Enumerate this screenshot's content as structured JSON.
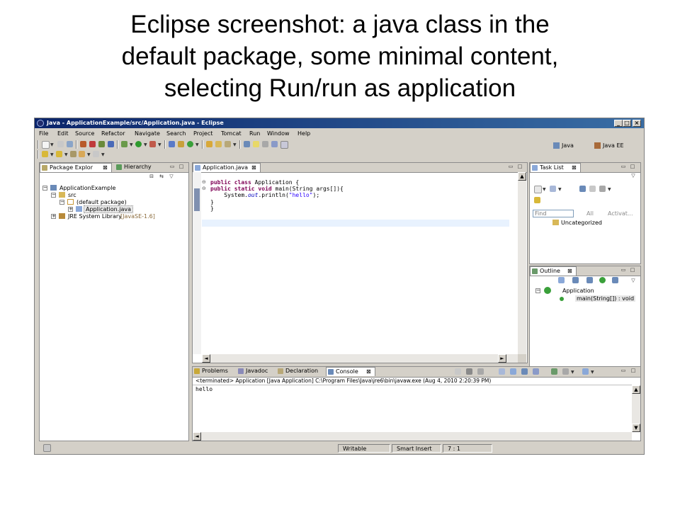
{
  "slide": {
    "title_lines": [
      "Eclipse screenshot: a java class in the",
      "default package, some minimal content,",
      "selecting Run/run as application"
    ]
  },
  "window": {
    "title": "Java - ApplicationExample/src/Application.java - Eclipse",
    "menu": [
      "File",
      "Edit",
      "Source",
      "Refactor",
      "Navigate",
      "Search",
      "Project",
      "Tomcat",
      "Run",
      "Window",
      "Help"
    ]
  },
  "perspectives": [
    "Java",
    "Java EE"
  ],
  "package_explorer": {
    "tabs": [
      "Package Explor",
      "Hierarchy"
    ],
    "tree": {
      "project": "ApplicationExample",
      "src": "src",
      "package": "(default package)",
      "file": "Application.java",
      "jre": "JRE System Library",
      "jre_version": "[JavaSE-1.6]"
    }
  },
  "editor": {
    "tab": "Application.java",
    "lines": [
      {
        "kw": "public class ",
        "rest": "Application {"
      },
      {
        "kw": "public static void ",
        "rest": "main(String args[]){"
      },
      {
        "pre": "    System.",
        "field": "out",
        "mid": ".println(",
        "str": "\"hello\"",
        "post": ");"
      },
      {
        "text": "}"
      },
      {
        "text": "}"
      }
    ]
  },
  "task_list": {
    "tab": "Task List",
    "find_placeholder": "Find",
    "all_label": "All",
    "activate_label": "Activat...",
    "uncategorized": "Uncategorized"
  },
  "outline": {
    "tab": "Outline",
    "class_name": "Application",
    "method": "main(String[]) : void"
  },
  "console": {
    "tabs": [
      "Problems",
      "Javadoc",
      "Declaration",
      "Console"
    ],
    "terminated_line": "<terminated> Application [Java Application] C:\\Program Files\\Java\\jre6\\bin\\javaw.exe (Aug 4, 2010 2:20:39 PM)",
    "output": "hello"
  },
  "status_bar": {
    "writable": "Writable",
    "insert_mode": "Smart Insert",
    "position": "7 : 1"
  },
  "colors": {
    "titlebar_start": "#0a246a",
    "titlebar_end": "#3a6ea5",
    "keyword": "#7f0055",
    "string": "#2a00ff",
    "field": "#0000c0",
    "chrome": "#d4d0c8"
  }
}
